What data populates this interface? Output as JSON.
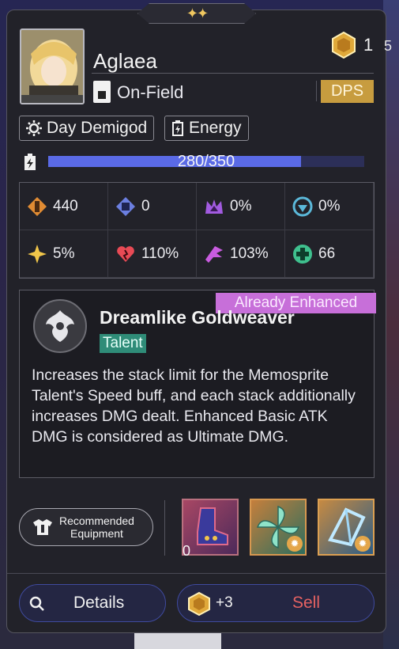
{
  "header": {
    "stars_glyph": "✦✦"
  },
  "character": {
    "name": "Aglaea",
    "position": "On-Field",
    "role_badge": "DPS",
    "currency_count": "1",
    "edge_number": "5"
  },
  "tags": [
    {
      "label": "Day Demigod",
      "icon": "sun-gear-icon"
    },
    {
      "label": "Energy",
      "icon": "battery-icon"
    }
  ],
  "energy": {
    "text": "280/350",
    "current": 280,
    "max": 350,
    "fill_color": "#5a6ae6"
  },
  "stats": [
    {
      "value": "440",
      "icon": "attack-icon",
      "color": "#e08b33"
    },
    {
      "value": "0",
      "icon": "defense-icon",
      "color": "#6b7fe0"
    },
    {
      "value": "0%",
      "icon": "crown-icon",
      "color": "#a25be0"
    },
    {
      "value": "0%",
      "icon": "shield-ring-icon",
      "color": "#5bb8d9"
    },
    {
      "value": "5%",
      "icon": "star-burst-icon",
      "color": "#f1c64a"
    },
    {
      "value": "110%",
      "icon": "heart-crack-icon",
      "color": "#e84a55"
    },
    {
      "value": "103%",
      "icon": "wing-icon",
      "color": "#c95ce0"
    },
    {
      "value": "66",
      "icon": "cross-heal-icon",
      "color": "#3fc08e"
    }
  ],
  "skill": {
    "badge": "Already Enhanced",
    "name": "Dreamlike Goldweaver",
    "type": "Talent",
    "description": "Increases the stack limit for the Memosprite Talent's Speed buff, and each stack additionally increases DMG dealt. Enhanced Basic ATK DMG is considered as Ultimate DMG."
  },
  "equipment": {
    "recommended_label_line1": "Recommended",
    "recommended_label_line2": "Equipment",
    "relic_count_label": "0"
  },
  "actions": {
    "details_label": "Details",
    "sell_bonus": "+3",
    "sell_label": "Sell"
  }
}
